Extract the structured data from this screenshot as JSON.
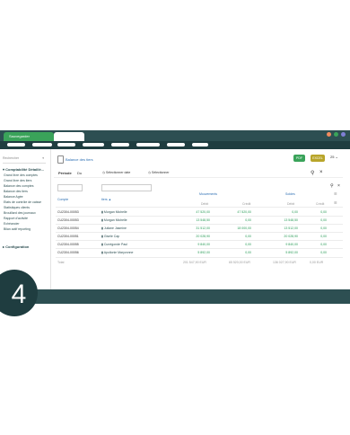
{
  "tabs": {
    "active": "Sauvegarder"
  },
  "window_dots": [
    "#f28b5f",
    "#3aa35a",
    "#7f7fd5"
  ],
  "sidebar": {
    "select_value": "Rechercher",
    "group_label": "Comptabilité Détaillé...",
    "items": [
      "Grand livre des comptes",
      "Grand livre des tiers",
      "Balance des comptes",
      "Balance des tiers",
      "Balance Agée",
      "Etats de contrôle de caisse",
      "Statistiques clients",
      "Brouillard des journaux",
      "Rapport d'activité",
      "Echéancier",
      "Bilan actif reporting"
    ],
    "config_label": "Configuration"
  },
  "main": {
    "title": "Balance des tiers",
    "pdf_label": "PDF",
    "excel_label": "EXCEL",
    "zoom": "25 ⌄",
    "filters": {
      "periode_label": "Période",
      "du_label": "Du",
      "start": "Sélectionner date",
      "end": "Sélectionner"
    }
  },
  "table": {
    "col_compte": "Compte",
    "col_tiers": "tiers ▲",
    "group_mouvements": "Mouvements",
    "group_soldes": "Soldes",
    "sub_debit": "Débit",
    "sub_credit": "Crédit",
    "rows": [
      {
        "compte": "CU2304-00053",
        "tiers": "Morgan Michelle",
        "mvt_debit": "47 520,00",
        "mvt_credit": "47 520,00",
        "solde_debit": "0,00",
        "solde_credit": "0,00"
      },
      {
        "compte": "CU2304-00053",
        "tiers": "Morgan Michelle",
        "mvt_debit": "13 548,50",
        "mvt_credit": "0,00",
        "solde_debit": "13 548,50",
        "solde_credit": "0,00"
      },
      {
        "compte": "CU2304-00054",
        "tiers": "Juliane Jasmine",
        "mvt_debit": "31 512,00",
        "mvt_credit": "18 000,00",
        "solde_debit": "13 512,00",
        "solde_credit": "0,00"
      },
      {
        "compte": "CU2304-00051",
        "tiers": "Gisele Cap",
        "mvt_debit": "20 028,90",
        "mvt_credit": "0,00",
        "solde_debit": "20 028,90",
        "solde_credit": "0,00"
      },
      {
        "compte": "CU2304-00055",
        "tiers": "Cunégonde Paul",
        "mvt_debit": "9 840,00",
        "mvt_credit": "0,00",
        "solde_debit": "9 840,00",
        "solde_credit": "0,00"
      },
      {
        "compte": "CU2304-00056",
        "tiers": "Apollonie Maryvonne",
        "mvt_debit": "5 892,00",
        "mvt_credit": "0,00",
        "solde_debit": "5 892,00",
        "solde_credit": "0,00"
      }
    ],
    "total_label": "Total",
    "totals": {
      "mvt_debit": "201 547,90 EUR",
      "mvt_credit": "65 520,00 EUR",
      "solde_debit": "136 027,90 EUR",
      "solde_credit": "0,00 EUR"
    }
  },
  "step_number": "4"
}
